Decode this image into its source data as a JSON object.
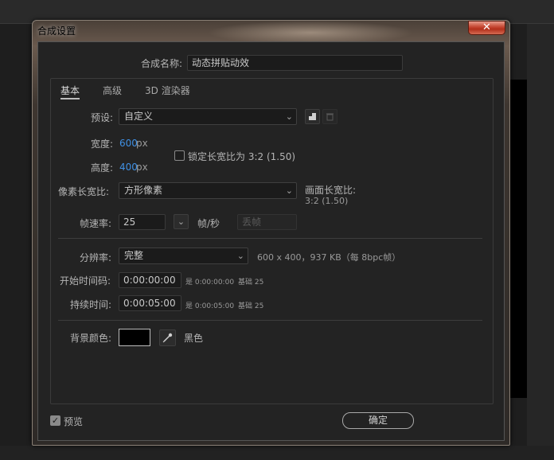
{
  "window": {
    "title": "合成设置",
    "close_glyph": "✕"
  },
  "comp_name": {
    "label": "合成名称:",
    "value": "动态拼贴动效"
  },
  "tabs": [
    {
      "label": "基本",
      "active": true
    },
    {
      "label": "高级",
      "active": false
    },
    {
      "label": "3D 渲染器",
      "active": false
    }
  ],
  "preset": {
    "label": "预设:",
    "value": "自定义",
    "chevron": "⌄",
    "save_icon": "floppy-icon",
    "delete_icon": "trash-icon"
  },
  "width": {
    "label": "宽度:",
    "value": "600",
    "unit": "px"
  },
  "height": {
    "label": "高度:",
    "value": "400",
    "unit": "px"
  },
  "lock_aspect": {
    "label": "锁定长宽比为 3:2 (1.50)",
    "checked": false
  },
  "pixel_aspect": {
    "label": "像素长宽比:",
    "value": "方形像素",
    "chevron": "⌄"
  },
  "frame_aspect": {
    "label": "画面长宽比:",
    "value": "3:2 (1.50)"
  },
  "frame_rate": {
    "label": "帧速率:",
    "value": "25",
    "chevron": "⌄",
    "unit": "帧/秒",
    "drop_frame": "丢帧"
  },
  "resolution": {
    "label": "分辨率:",
    "value": "完整",
    "chevron": "⌄",
    "info": "600 x 400，937 KB（每 8bpc帧）"
  },
  "start_time": {
    "label": "开始时间码:",
    "value": "0:00:00:00",
    "note_is": "是 0:00:00:00",
    "note_base": "基础 25"
  },
  "duration": {
    "label": "持续时间:",
    "value": "0:00:05:00",
    "note_is": "是 0:00:05:00",
    "note_base": "基础 25"
  },
  "background": {
    "label": "背景颜色:",
    "color": "#000000",
    "color_name": "黑色",
    "eyedropper_icon": "eyedropper-icon"
  },
  "footer": {
    "preview_label": "预览",
    "preview_checked": true,
    "ok_label": "确定"
  }
}
